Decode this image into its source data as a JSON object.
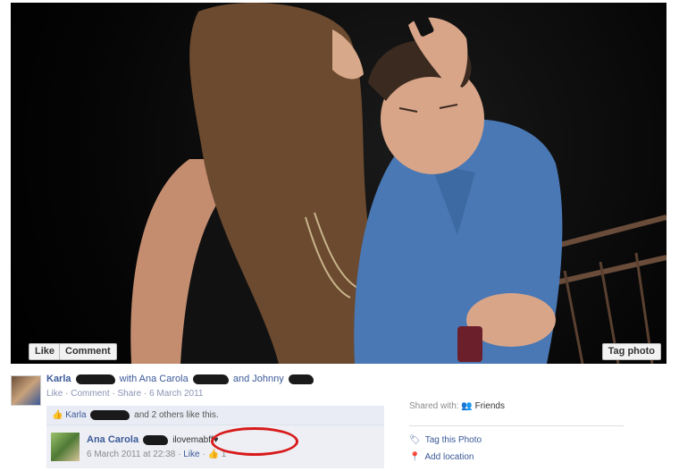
{
  "photo": {
    "like_label": "Like",
    "comment_label": "Comment",
    "tag_label": "Tag photo"
  },
  "post": {
    "author": "Karla",
    "with_text": "with Ana Carola",
    "and_text": "and Johnny",
    "actions": {
      "like": "Like",
      "comment": "Comment",
      "share": "Share",
      "date": "6 March 2011"
    },
    "likes": {
      "name": "Karla",
      "others_text": "and 2 others like this."
    },
    "comment": {
      "author": "Ana Carola",
      "text": "ilovemabff♥",
      "timestamp": "6 March 2011 at 22:38",
      "like": "Like",
      "like_count": "1"
    }
  },
  "sidebar": {
    "shared_with_label": "Shared with:",
    "audience": "Friends",
    "tag_photo": "Tag this Photo",
    "add_location": "Add location"
  },
  "colors": {
    "link": "#3b5998",
    "highlight_circle": "#d81a1a"
  }
}
